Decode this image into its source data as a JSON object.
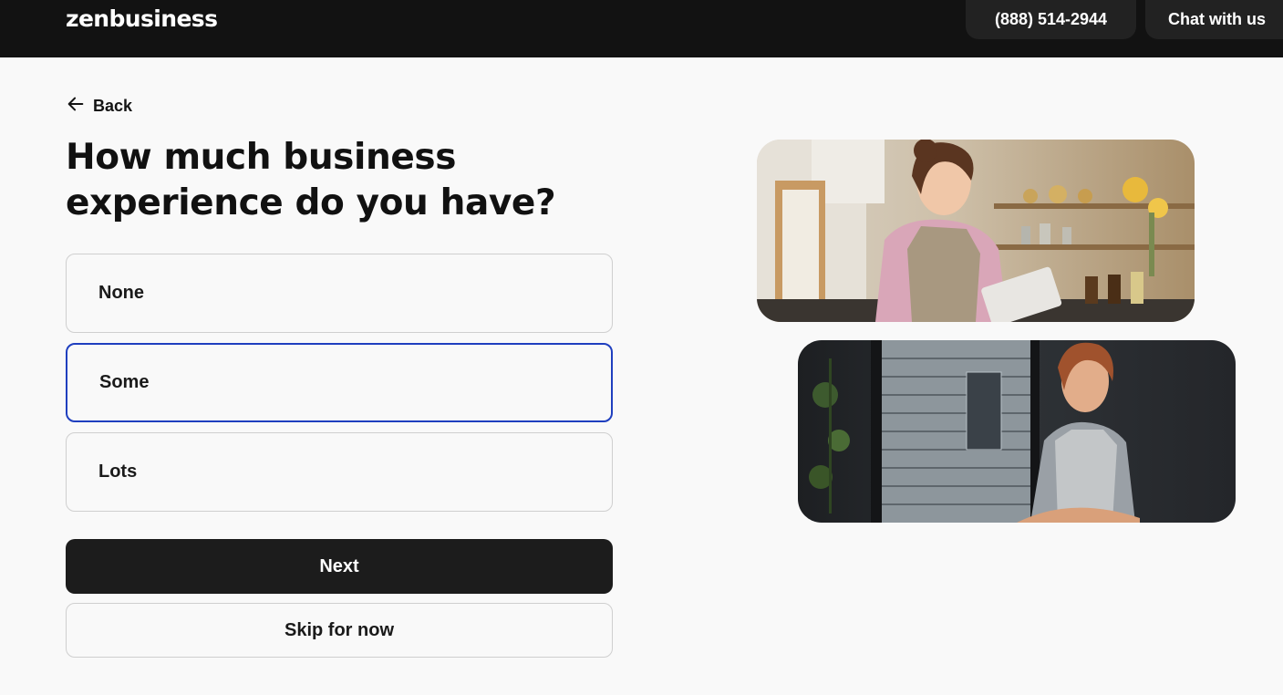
{
  "header": {
    "logo": "zenbusiness",
    "phone_label": "(888) 514-2944",
    "chat_label": "Chat with us"
  },
  "nav": {
    "back_label": "Back"
  },
  "question": {
    "title": "How much business experience do you have?",
    "options": [
      {
        "label": "None",
        "selected": false
      },
      {
        "label": "Some",
        "selected": true
      },
      {
        "label": "Lots",
        "selected": false
      }
    ]
  },
  "actions": {
    "next_label": "Next",
    "skip_label": "Skip for now"
  },
  "colors": {
    "header_bg": "#121212",
    "selected_border": "#1f3fbf",
    "primary_button": "#1c1c1c",
    "page_bg": "#f9f9f9"
  }
}
